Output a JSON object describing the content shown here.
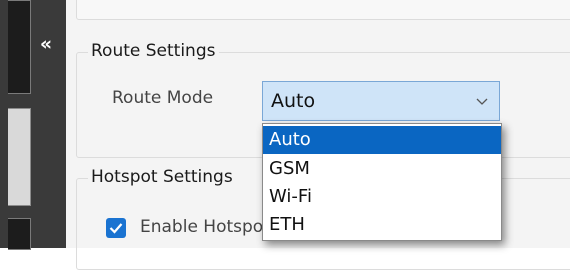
{
  "sidebar": {
    "collapse_glyph": "«"
  },
  "route_settings": {
    "title": "Route Settings",
    "route_mode_label": "Route Mode",
    "route_mode_value": "Auto",
    "options": [
      "Auto",
      "GSM",
      "Wi-Fi",
      "ETH"
    ],
    "selected_index": 0
  },
  "hotspot_settings": {
    "title": "Hotspot Settings",
    "enable_label": "Enable Hotspot",
    "enable_checked": true
  },
  "colors": {
    "sidebar_bg": "#3a3a3a",
    "selected_bg": "#0a66c2",
    "combo_bg": "#cfe4f8",
    "checkbox_bg": "#1a73d1"
  }
}
